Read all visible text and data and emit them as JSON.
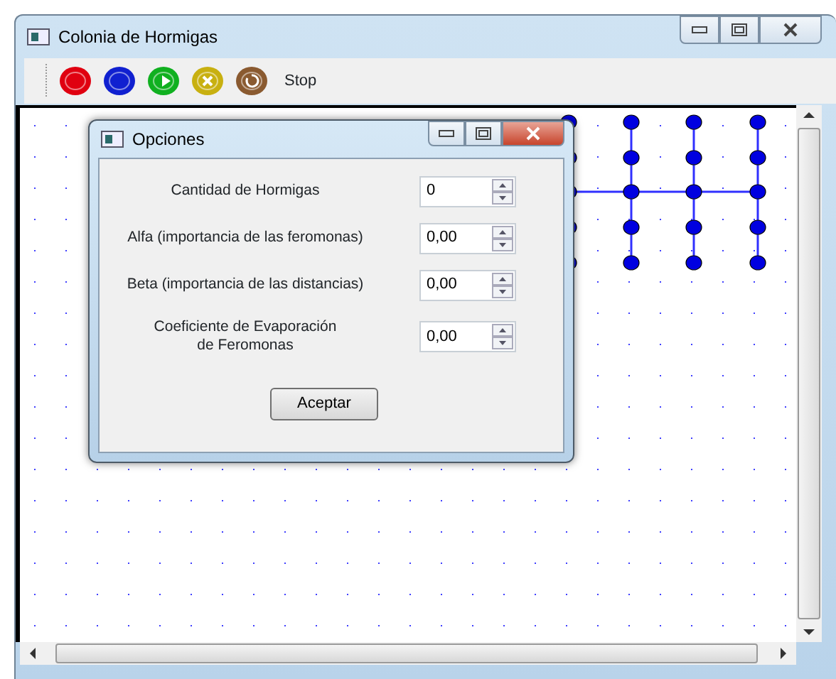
{
  "window": {
    "title": "Colonia de Hormigas"
  },
  "toolbar": {
    "label": "Stop"
  },
  "dialog": {
    "title": "Opciones",
    "fields": [
      {
        "label": "Cantidad de Hormigas",
        "value": "0"
      },
      {
        "label": "Alfa (importancia de las feromonas)",
        "value": "0,00"
      },
      {
        "label": "Beta (importancia de las distancias)",
        "value": "0,00"
      },
      {
        "label": "Coeficiente de Evaporación\nde Feromonas",
        "value": "0,00"
      }
    ],
    "button": "Aceptar"
  }
}
